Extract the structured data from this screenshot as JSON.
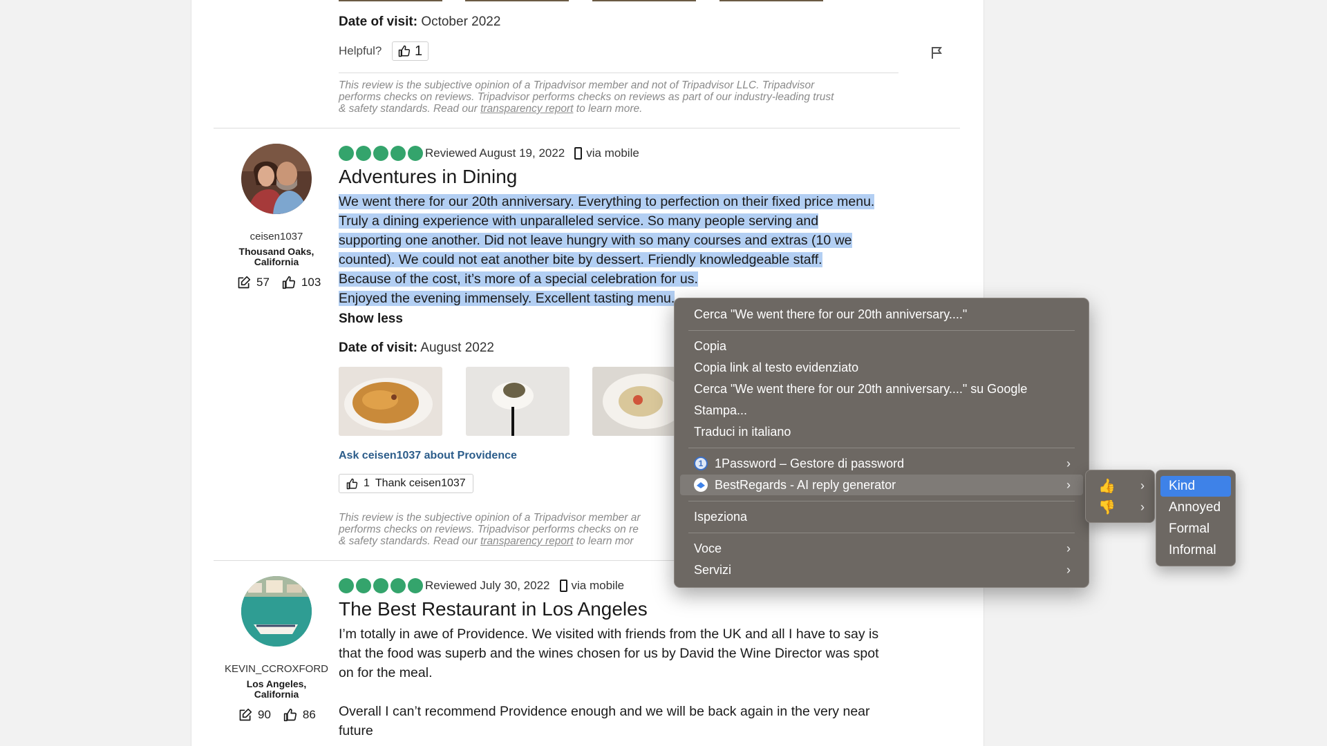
{
  "review_prev": {
    "date_label": "Date of visit:",
    "date_value": "October 2022",
    "helpful_label": "Helpful?",
    "helpful_count": "1",
    "disclaimer_line1": "This review is the subjective opinion of a Tripadvisor member and not of Tripadvisor LLC. Tripadvisor",
    "disclaimer_line2": "performs checks on reviews. Tripadvisor performs checks on reviews as part of our industry-leading trust",
    "disclaimer_line3_a": "& safety standards. Read our ",
    "disclaimer_link": "transparency report",
    "disclaimer_line3_b": " to learn more."
  },
  "review_1": {
    "username": "ceisen1037",
    "location_line1": "Thousand Oaks,",
    "location_line2": "California",
    "contributions": "57",
    "helpful_votes": "103",
    "rating": 5,
    "reviewed": "Reviewed August 19, 2022",
    "via": "via mobile",
    "title": "Adventures in Dining",
    "body_lines": [
      "We went there for our 20th anniversary. Everything to perfection on their fixed price menu.",
      "Truly a dining experience with unparalleled service. So many people serving and",
      "supporting one another. Did not leave hungry with so many courses and extras (10 we",
      "counted). We could not eat another bite by dessert. Friendly knowledgeable staff.",
      "Because of the cost, it’s more of a special celebration for us.",
      "Enjoyed the evening immensely. Excellent tasting menu."
    ],
    "show_less": "Show less",
    "date_label": "Date of visit:",
    "date_value": "August 2022",
    "ask_link": "Ask ceisen1037 about Providence",
    "thank_count": "1",
    "thank_label": "Thank ceisen1037",
    "disclaimer_line1": "This review is the subjective opinion of a Tripadvisor member ar",
    "disclaimer_line2": "performs checks on reviews. Tripadvisor performs checks on re",
    "disclaimer_line3_a": "& safety standards. Read our ",
    "disclaimer_link": "transparency report",
    "disclaimer_line3_b": " to learn mor"
  },
  "review_2": {
    "username": "KEVIN_CCROXFORD",
    "location_line1": "Los Angeles,",
    "location_line2": "California",
    "contributions": "90",
    "helpful_votes": "86",
    "rating": 5,
    "reviewed": "Reviewed July 30, 2022",
    "via": "via mobile",
    "title": "The Best Restaurant in Los Angeles",
    "body_lines": [
      "I’m totally in awe of Providence. We visited with friends from the UK and all I have to say is",
      "that the food was superb and the wines chosen for us by David the Wine Director was spot",
      "on for the meal.",
      "",
      "Overall I can’t recommend Providence enough and we will be back again in the very near",
      "future"
    ]
  },
  "context_menu": {
    "search": "Cerca \"We went there for our 20th anniversary....\"",
    "copy": "Copia",
    "copy_link": "Copia link al testo evidenziato",
    "search_google": "Cerca \"We went there for our 20th anniversary....\" su Google",
    "print": "Stampa...",
    "translate": "Traduci in italiano",
    "onepassword": "1Password – Gestore di password",
    "bestregards": "BestRegards - AI reply generator",
    "inspect": "Ispeziona",
    "voice": "Voce",
    "services": "Servizi"
  },
  "submenu_thumbs": [
    "👍",
    "👎"
  ],
  "submenu_tones": [
    "Kind",
    "Annoyed",
    "Formal",
    "Informal"
  ],
  "colors": {
    "rating_green": "#34a46c",
    "selection": "#b3cff3",
    "menu_bg": "#6d6863",
    "menu_highlight": "#3e82e8",
    "link": "#2b5c8a"
  }
}
